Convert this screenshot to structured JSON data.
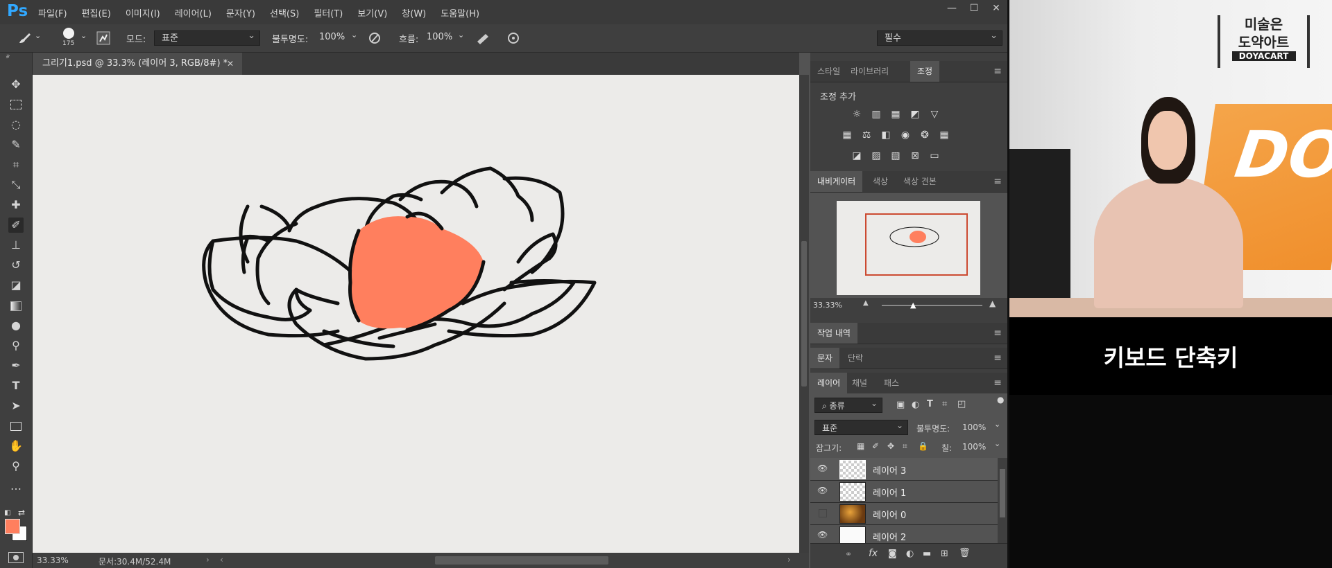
{
  "app": {
    "logo": "Ps"
  },
  "menu": [
    "파일(F)",
    "편집(E)",
    "이미지(I)",
    "레이어(L)",
    "문자(Y)",
    "선택(S)",
    "필터(T)",
    "보기(V)",
    "창(W)",
    "도움말(H)"
  ],
  "window_controls": {
    "minimize": "—",
    "restore": "☐",
    "close": "✕"
  },
  "options": {
    "brush_size": "175",
    "mode_label": "모드:",
    "mode_value": "표준",
    "opacity_label": "불투명도:",
    "opacity_value": "100%",
    "flow_label": "흐름:",
    "flow_value": "100%",
    "workspace": "필수"
  },
  "document": {
    "tab_title": "그리기1.psd @ 33.3% (레이어 3, RGB/8#) *",
    "zoom": "33.33%",
    "doc_size": "문서:30.4M/52.4M"
  },
  "panels": {
    "top_tabs": [
      "스타일",
      "라이브러리",
      "조정"
    ],
    "adjust_title": "조정 추가",
    "nav_tabs": [
      "내비게이터",
      "색상",
      "색상 견본"
    ],
    "nav_zoom": "33.33%",
    "history": "작업 내역",
    "char_tabs": [
      "문자",
      "단락"
    ],
    "layer_tabs": [
      "레이어",
      "채널",
      "패스"
    ],
    "filter_kind": "종류",
    "blend_mode": "표준",
    "opacity_label": "불투명도:",
    "opacity_value": "100%",
    "lock_label": "잠그기:",
    "fill_label": "칠:",
    "fill_value": "100%",
    "layers": [
      {
        "name": "레이어 3",
        "visible": true,
        "selected": true
      },
      {
        "name": "레이어 1",
        "visible": true,
        "selected": false
      },
      {
        "name": "레이어 0",
        "visible": false,
        "selected": false
      },
      {
        "name": "레이어 2",
        "visible": true,
        "selected": false
      }
    ]
  },
  "colors": {
    "foreground": "#ff7f5e",
    "background": "#ffffff",
    "petal_fill": "#ff7f5e",
    "canvas": "#ecebe9"
  },
  "video": {
    "logo_line1": "미술은",
    "logo_line2": "도약아트",
    "logo_brand": "DOYACART",
    "banner_text": "DO",
    "caption": "키보드 단축키"
  }
}
